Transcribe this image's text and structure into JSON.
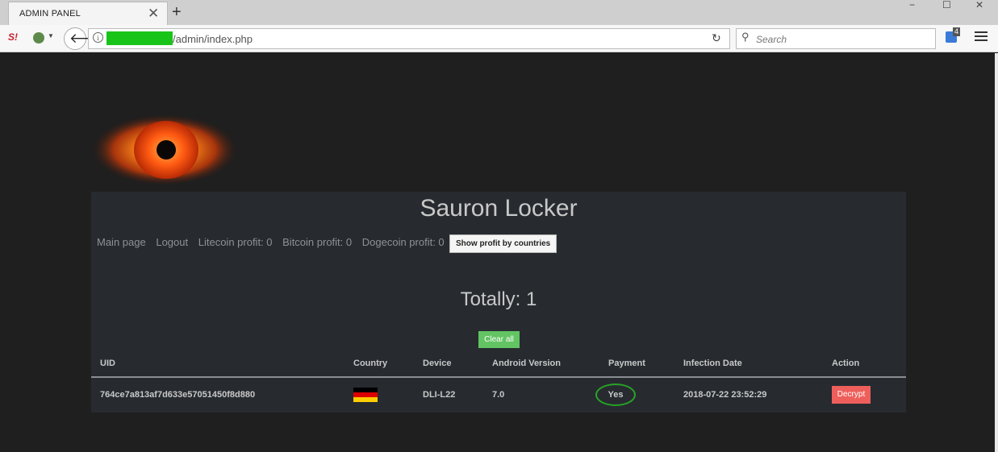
{
  "browser": {
    "tab_title": "ADMIN PANEL",
    "tab_close": "✕",
    "new_tab": "+",
    "window_controls": {
      "minimize": "−",
      "maximize": "☐",
      "close": "✕"
    },
    "toolbar_logo": "S!",
    "url_path": "/admin/index.php",
    "url_redaction_color": "#19c419",
    "reload_icon": "reload-icon",
    "search_placeholder": "Search",
    "extension_badge_count": "4"
  },
  "page": {
    "title": "Sauron Locker",
    "nav": {
      "main_page": "Main page",
      "logout": "Logout",
      "litecoin_profit": "Litecoin profit: 0",
      "bitcoin_profit": "Bitcoin profit: 0",
      "dogecoin_profit": "Dogecoin profit: 0",
      "show_profit_button": "Show profit by countries"
    },
    "totally": "Totally: 1",
    "clear_all_button": "Clear all",
    "table": {
      "headers": {
        "uid": "UID",
        "country": "Country",
        "device": "Device",
        "android_version": "Android Version",
        "payment": "Payment",
        "infection_date": "Infection Date",
        "action": "Action"
      },
      "rows": [
        {
          "uid": "764ce7a813af7d633e57051450f8d880",
          "country_flag": "germany-flag-icon",
          "device": "DLI-L22",
          "android_version": "7.0",
          "payment": "Yes",
          "infection_date": "2018-07-22 23:52:29",
          "action": "Decrypt"
        }
      ]
    }
  },
  "colors": {
    "page_background": "#1f1f1f",
    "panel_background": "#272b30",
    "clear_button": "#62c462",
    "decrypt_button": "#ee5f5b",
    "payment_highlight": "#26a326"
  }
}
